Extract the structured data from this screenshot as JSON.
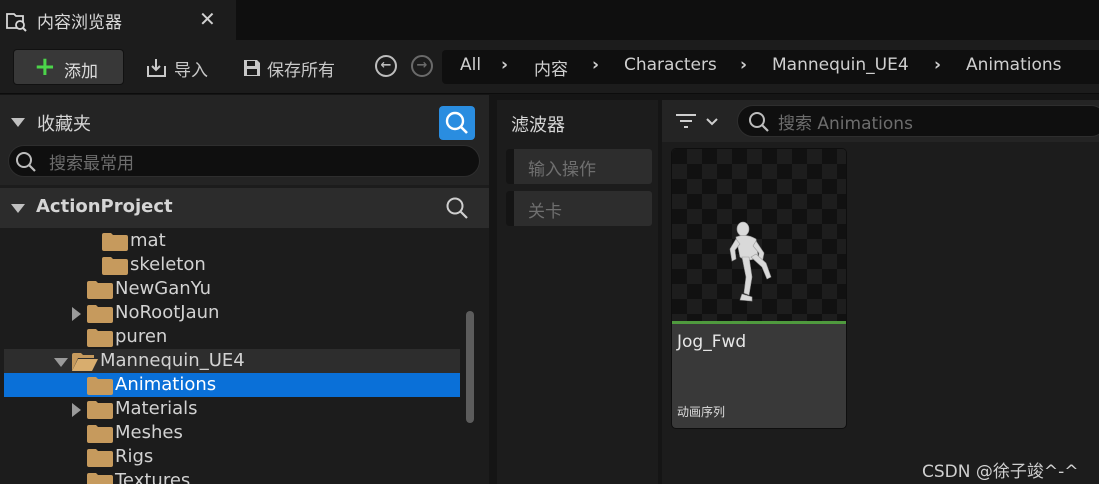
{
  "tab": {
    "title": "内容浏览器",
    "close": "✕",
    "icon": "content-browser-icon"
  },
  "toolbar": {
    "add_label": "添加",
    "import_label": "导入",
    "save_all_label": "保存所有",
    "back_icon": "arrow-left-circle-icon",
    "forward_icon": "arrow-right-circle-icon"
  },
  "breadcrumb": [
    "All",
    "内容",
    "Characters",
    "Mannequin_UE4",
    "Animations"
  ],
  "favorites": {
    "title": "收藏夹",
    "search_placeholder": "搜索最常用"
  },
  "project": {
    "title": "ActionProject",
    "tree": [
      {
        "label": "mat"
      },
      {
        "label": "skeleton"
      },
      {
        "label": "NewGanYu"
      },
      {
        "label": "NoRootJaun"
      },
      {
        "label": "puren"
      },
      {
        "label": "Mannequin_UE4"
      },
      {
        "label": "Animations"
      },
      {
        "label": "Materials"
      },
      {
        "label": "Meshes"
      },
      {
        "label": "Rigs"
      },
      {
        "label": "Textures"
      }
    ]
  },
  "filters": {
    "title": "滤波器",
    "items": [
      "输入操作",
      "关卡"
    ]
  },
  "content": {
    "search_placeholder": "搜索 Animations",
    "assets": [
      {
        "name": "Jog_Fwd",
        "type": "动画序列"
      }
    ]
  },
  "watermark": "CSDN @徐子竣^-^",
  "colors": {
    "accent": "#0a70d8",
    "add_plus": "#4cd44a",
    "search_button": "#2a8de0",
    "folder": "#c69a5d"
  }
}
